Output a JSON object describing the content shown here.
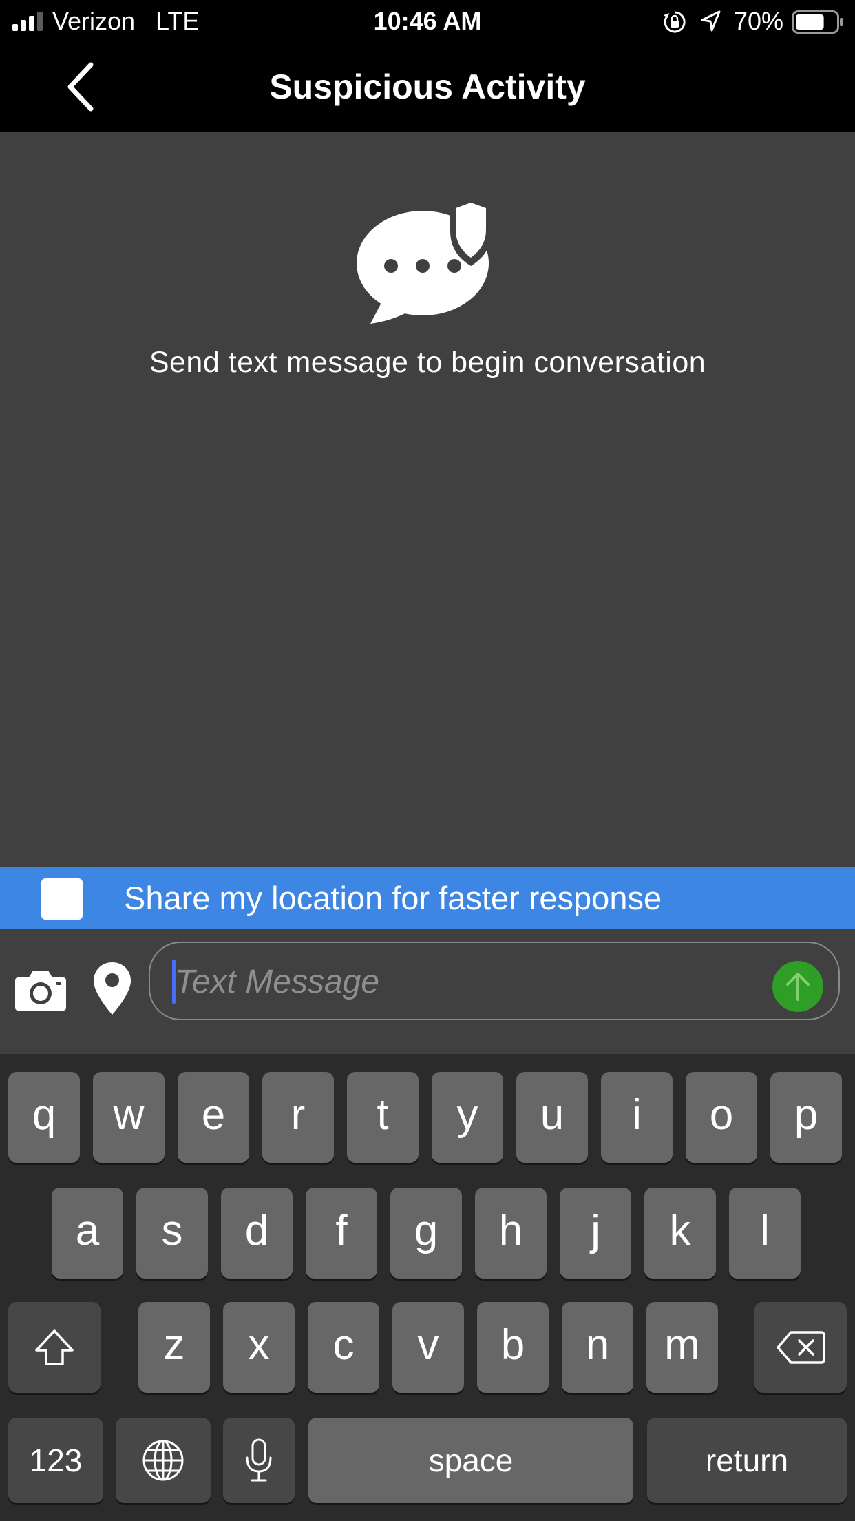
{
  "status_bar": {
    "carrier": "Verizon",
    "network": "LTE",
    "time": "10:46 AM",
    "battery_percent": "70%",
    "battery_level": 0.7,
    "icons": [
      "signal-icon",
      "orientation-lock-icon",
      "location-arrow-icon",
      "battery-icon"
    ]
  },
  "nav": {
    "title": "Suspicious Activity",
    "back_icon": "chevron-left-icon"
  },
  "conversation": {
    "icon": "chat-shield-icon",
    "empty_message": "Send text message to begin conversation"
  },
  "location_share": {
    "label": "Share my location for faster response",
    "checked": false
  },
  "composer": {
    "camera_icon": "camera-icon",
    "pin_icon": "map-pin-icon",
    "placeholder": "Text Message",
    "value": "",
    "send_icon": "arrow-up-icon",
    "send_color": "#2f9e27"
  },
  "keyboard": {
    "row1": [
      "q",
      "w",
      "e",
      "r",
      "t",
      "y",
      "u",
      "i",
      "o",
      "p"
    ],
    "row2": [
      "a",
      "s",
      "d",
      "f",
      "g",
      "h",
      "j",
      "k",
      "l"
    ],
    "row3": [
      "z",
      "x",
      "c",
      "v",
      "b",
      "n",
      "m"
    ],
    "numbers_label": "123",
    "space_label": "space",
    "return_label": "return"
  },
  "colors": {
    "banner": "#3e86e3",
    "background": "#404040",
    "keyboard": "#2b2b2b"
  }
}
